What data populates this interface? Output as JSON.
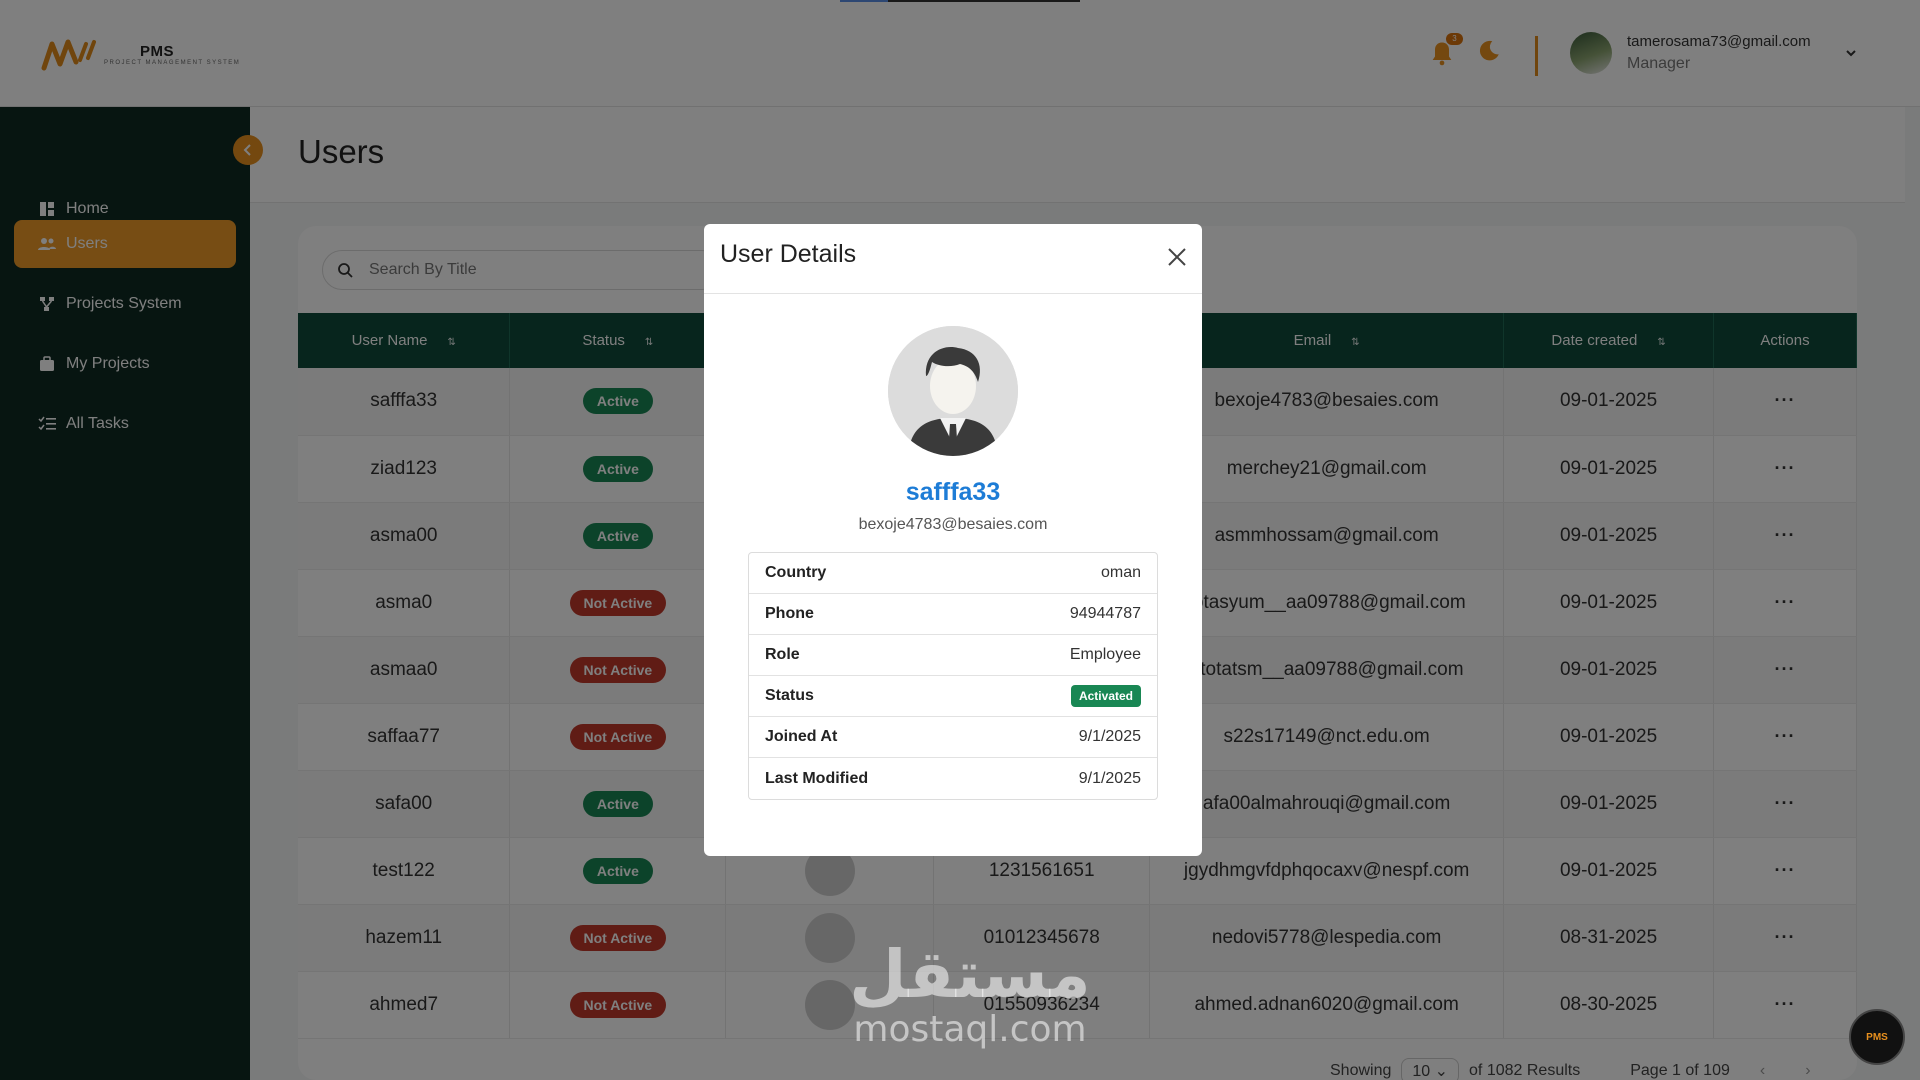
{
  "header": {
    "logo_title": "PMS",
    "logo_subtitle": "PROJECT MANAGEMENT SYSTEM",
    "notification_count": "3",
    "user_email": "tamerosama73@gmail.com",
    "user_role": "Manager",
    "icons": [
      "bell-icon",
      "moon-icon",
      "chevron-down-icon"
    ]
  },
  "sidebar": {
    "items": [
      {
        "label": "Home",
        "icon": "home-icon",
        "active": false
      },
      {
        "label": "Users",
        "icon": "users-icon",
        "active": true
      },
      {
        "label": "Projects System",
        "icon": "projects-icon",
        "active": false
      },
      {
        "label": "My Projects",
        "icon": "briefcase-icon",
        "active": false
      },
      {
        "label": "All Tasks",
        "icon": "tasks-icon",
        "active": false
      }
    ]
  },
  "page": {
    "title": "Users",
    "search_placeholder": "Search By Title"
  },
  "table": {
    "columns": [
      "User Name",
      "Status",
      "",
      "",
      "Email",
      "Date created",
      "Actions"
    ],
    "rows": [
      {
        "name": "safffa33",
        "status": "Active",
        "phone": "",
        "email": "bexoje4783@besaies.com",
        "date": "09-01-2025"
      },
      {
        "name": "ziad123",
        "status": "Active",
        "phone": "",
        "email": "merchey21@gmail.com",
        "date": "09-01-2025"
      },
      {
        "name": "asma00",
        "status": "Active",
        "phone": "",
        "email": "asmmhossam@gmail.com",
        "date": "09-01-2025"
      },
      {
        "name": "asma0",
        "status": "Not Active",
        "phone": "",
        "email": "totasyum__aa09788@gmail.com",
        "date": "09-01-2025"
      },
      {
        "name": "asmaa0",
        "status": "Not Active",
        "phone": "",
        "email": "etotatsm__aa09788@gmail.com",
        "date": "09-01-2025"
      },
      {
        "name": "saffaa77",
        "status": "Not Active",
        "phone": "",
        "email": "s22s17149@nct.edu.om",
        "date": "09-01-2025"
      },
      {
        "name": "safa00",
        "status": "Active",
        "phone": "",
        "email": "afa00almahrouqi@gmail.com",
        "date": "09-01-2025"
      },
      {
        "name": "test122",
        "status": "Active",
        "phone": "1231561651",
        "email": "jgydhmgvfdphqocaxv@nespf.com",
        "date": "09-01-2025"
      },
      {
        "name": "hazem11",
        "status": "Not Active",
        "phone": "01012345678",
        "email": "nedovi5778@lespedia.com",
        "date": "08-31-2025"
      },
      {
        "name": "ahmed7",
        "status": "Not Active",
        "phone": "01550936234",
        "email": "ahmed.adnan6020@gmail.com",
        "date": "08-30-2025"
      }
    ],
    "actions_label": "···"
  },
  "pagination": {
    "showing_label": "Showing",
    "page_size": "10",
    "results_label": "of 1082 Results",
    "page_label": "Page 1 of 109"
  },
  "modal": {
    "title": "User Details",
    "username": "safffa33",
    "email": "bexoje4783@besaies.com",
    "details": [
      {
        "label": "Country",
        "value": "oman"
      },
      {
        "label": "Phone",
        "value": "94944787"
      },
      {
        "label": "Role",
        "value": "Employee"
      },
      {
        "label": "Status",
        "value": "Activated"
      },
      {
        "label": "Joined At",
        "value": "9/1/2025"
      },
      {
        "label": "Last Modified",
        "value": "9/1/2025"
      }
    ]
  },
  "watermark": {
    "arabic": "مستقل",
    "latin": "mostaql.com"
  },
  "fab_label": "PMS",
  "colors": {
    "sidebar_bg": "#0e2a22",
    "accent": "#ef9b28",
    "table_header": "#0e4a3a",
    "active_badge": "#198754",
    "inactive_badge": "#c0392b",
    "username_link": "#1d7cd6"
  }
}
